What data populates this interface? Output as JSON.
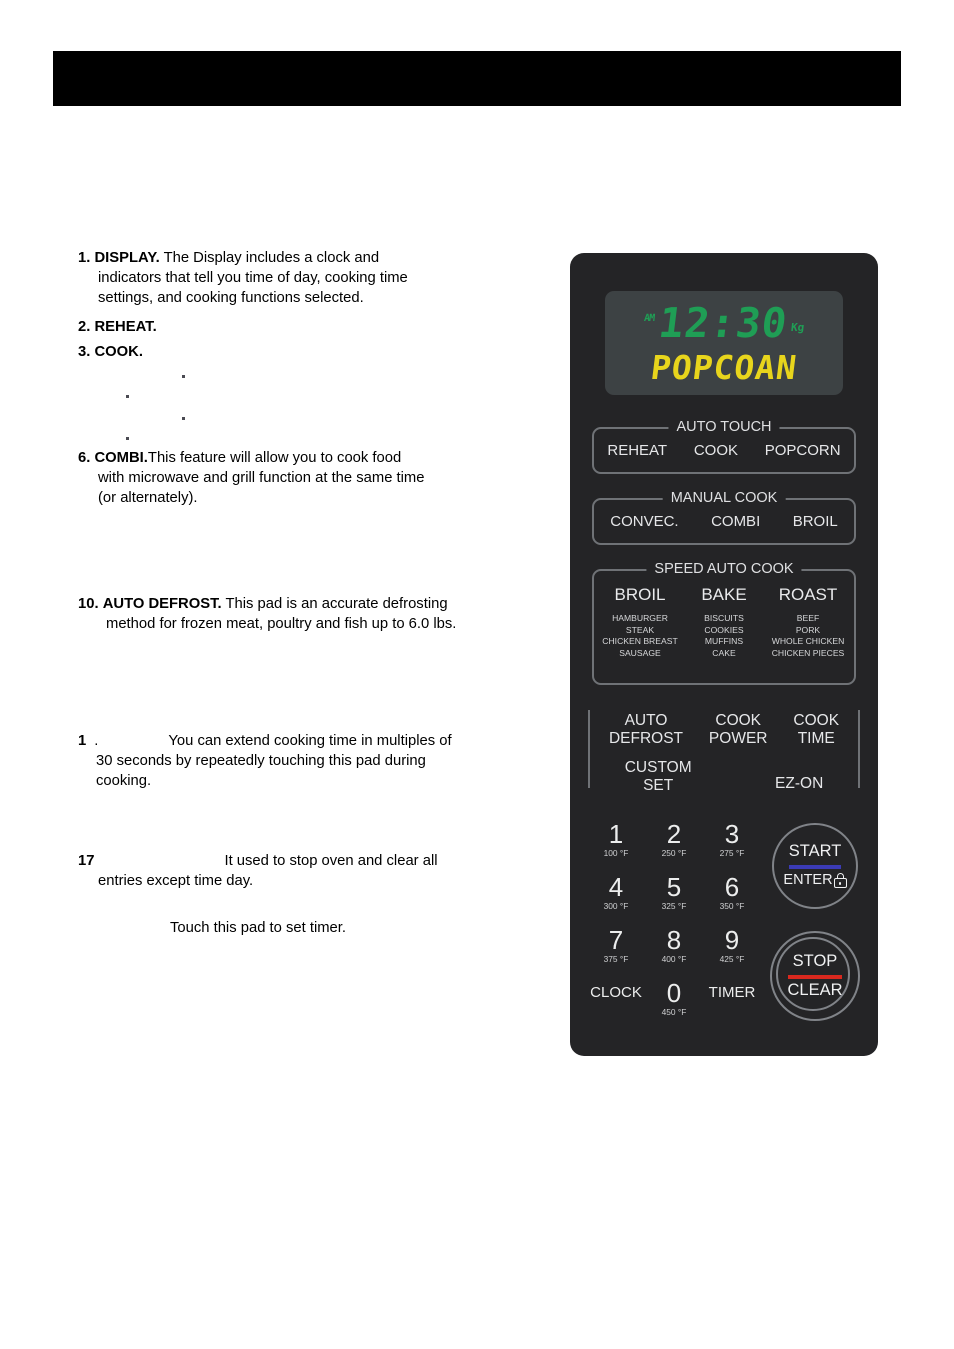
{
  "document": {
    "banner_text": ""
  },
  "instructions": [
    {
      "number": "1.",
      "term": "DISPLAY.",
      "lines": [
        "The Display includes a clock and",
        "indicators that tell you time of day, cooking time",
        "settings, and cooking functions selected."
      ]
    },
    {
      "number": "2.",
      "term": "REHEAT.",
      "lines": []
    },
    {
      "number": "3.",
      "term": "COOK.",
      "lines": []
    },
    {
      "number": "6.",
      "term": "COMBI.",
      "lines": [
        "This feature will allow you to cook food",
        "with microwave and grill function at the same time",
        "(or alternately)."
      ]
    },
    {
      "number": "10.",
      "term": "AUTO DEFROST.",
      "lines": [
        "This pad is an accurate defrosting",
        "method for frozen meat, poultry and fish up to 6.0 lbs."
      ]
    },
    {
      "number": "1",
      "term": ".",
      "lines": [
        "You can extend cooking time in multiples of",
        "30 seconds by repeatedly touching this pad during",
        "cooking."
      ]
    },
    {
      "number": "17",
      "term": "",
      "lines": [
        "It used to stop oven and clear all",
        "entries except time day."
      ]
    }
  ],
  "timer_note": "Touch this pad to set timer.",
  "control_panel": {
    "display": {
      "am_indicator": "AM",
      "clock": "12:30",
      "unit_indicator": "Kg",
      "message": "POPCOAN",
      "clock_color": "#1f9e55",
      "message_color": "#e8d51c",
      "screen_color": "#3d4244"
    },
    "groups": [
      {
        "title": "AUTO TOUCH",
        "buttons": [
          "REHEAT",
          "COOK",
          "POPCORN"
        ]
      },
      {
        "title": "MANUAL COOK",
        "buttons": [
          "CONVEC.",
          "COMBI",
          "BROIL"
        ]
      }
    ],
    "speed_auto_cook": {
      "title": "SPEED AUTO COOK",
      "columns": [
        {
          "head": "BROIL",
          "items": [
            "HAMBURGER",
            "STEAK",
            "CHICKEN BREAST",
            "SAUSAGE"
          ]
        },
        {
          "head": "BAKE",
          "items": [
            "BISCUITS",
            "COOKIES",
            "MUFFINS",
            "CAKE"
          ]
        },
        {
          "head": "ROAST",
          "items": [
            "BEEF",
            "PORK",
            "WHOLE CHICKEN",
            "CHICKEN PIECES"
          ]
        }
      ]
    },
    "function_pads": {
      "row_a": [
        {
          "line1": "AUTO",
          "line2": "DEFROST"
        },
        {
          "line1": "COOK",
          "line2": "POWER"
        },
        {
          "line1": "COOK",
          "line2": "TIME"
        }
      ],
      "row_b": [
        {
          "line1": "CUSTOM",
          "line2": "SET"
        },
        {
          "line1": "EZ-ON",
          "line2": ""
        }
      ]
    },
    "keypad": [
      [
        {
          "label": "1",
          "temp": "100 °F"
        },
        {
          "label": "2",
          "temp": "250 °F"
        },
        {
          "label": "3",
          "temp": "275 °F"
        }
      ],
      [
        {
          "label": "4",
          "temp": "300 °F"
        },
        {
          "label": "5",
          "temp": "325 °F"
        },
        {
          "label": "6",
          "temp": "350 °F"
        }
      ],
      [
        {
          "label": "7",
          "temp": "375 °F"
        },
        {
          "label": "8",
          "temp": "400 °F"
        },
        {
          "label": "9",
          "temp": "425 °F"
        }
      ]
    ],
    "bottom_row": {
      "clock_label": "CLOCK",
      "zero_label": "0",
      "zero_temp": "450 °F",
      "timer_label": "TIMER"
    },
    "start_button": {
      "top_label": "START",
      "bottom_label": "ENTER",
      "bar_color": "#3b3bb5",
      "lock_icon": "lock-icon"
    },
    "stop_button": {
      "top_label": "STOP",
      "bottom_label": "CLEAR",
      "bar_color": "#d9281e"
    }
  }
}
